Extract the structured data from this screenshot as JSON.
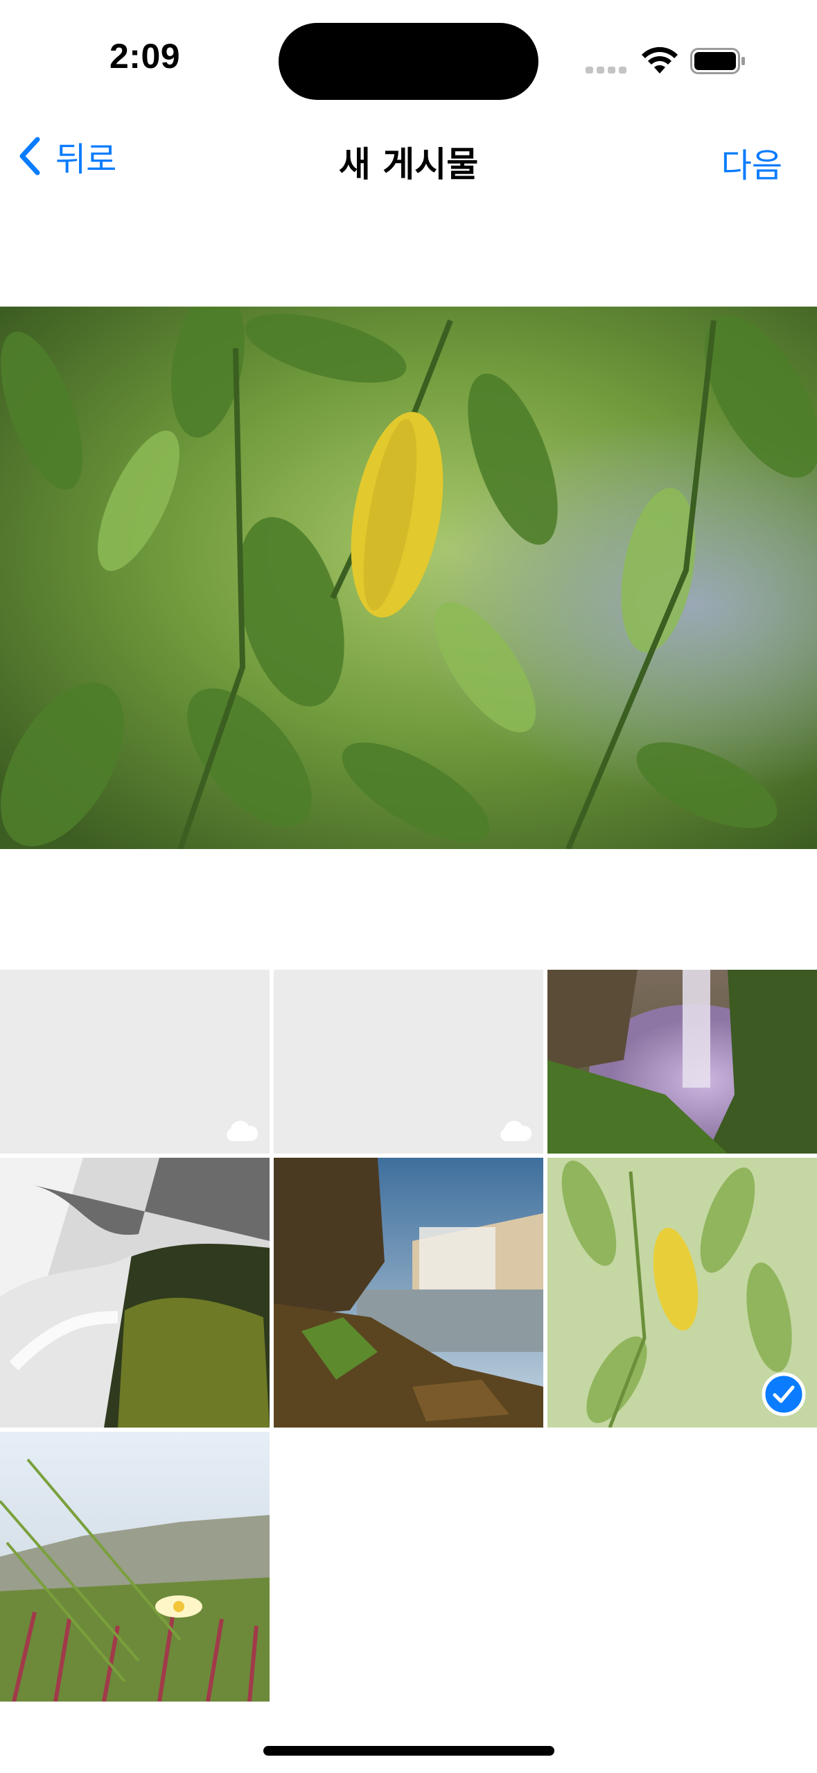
{
  "status": {
    "time": "2:09"
  },
  "nav": {
    "back_label": "뒤로",
    "title": "새 게시물",
    "next_label": "다음"
  },
  "accent_color": "#0a7cff",
  "preview": {
    "image": "citrus-leaves-photo"
  },
  "grid": [
    {
      "name": "photo-placeholder-1",
      "icon": "cloud-icon"
    },
    {
      "name": "photo-placeholder-2",
      "icon": "cloud-icon"
    },
    {
      "name": "photo-waterfall-cave"
    },
    {
      "name": "photo-waterfall-moss"
    },
    {
      "name": "photo-waterfall-cliff"
    },
    {
      "name": "photo-citrus-leaves",
      "selected": true,
      "icon": "checkmark-icon"
    },
    {
      "name": "photo-ice-plant-flower"
    }
  ]
}
